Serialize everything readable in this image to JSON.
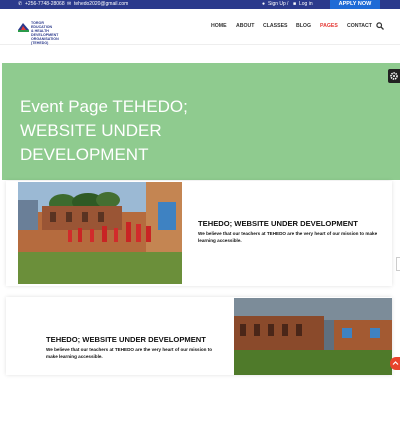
{
  "topbar": {
    "phone": "+256-7748-28068",
    "email": "tehedo2020@gmail.com",
    "signup": "Sign Up",
    "separator": "/",
    "login": "Log in",
    "apply": "APPLY NOW"
  },
  "brand": {
    "logo_line1": "TOROR EDUCATION",
    "logo_line2": "& HEALTH DEVELOPMENT",
    "logo_line3": "ORGANISATION (TEHEDO)"
  },
  "nav": [
    "HOME",
    "ABOUT",
    "CLASSES",
    "BLOG",
    "PAGES",
    "CONTACT"
  ],
  "hero": {
    "title": "Event Page TEHEDO; WEBSITE UNDER DEVELOPMENT"
  },
  "cards": [
    {
      "title": "TEHEDO; WEBSITE UNDER DEVELOPMENT",
      "text": "We believe that our teachers at TEHEDO are the very heart of our mission to make learning accessible."
    },
    {
      "title": "TEHEDO; WEBSITE UNDER DEVELOPMENT",
      "text": "We believe that our teachers at TEHEDO are the very heart of our mission to make learning accessible."
    }
  ],
  "colors": {
    "topbar": "#2b3a8c",
    "apply": "#1e6bd6",
    "hero": "#8fcb8f",
    "active_nav": "#e53935",
    "scroll_top": "#e8442d"
  },
  "icons": [
    "phone-icon",
    "email-icon",
    "user-icon",
    "lock-icon",
    "search-icon",
    "gear-icon",
    "chevron-up-icon"
  ]
}
